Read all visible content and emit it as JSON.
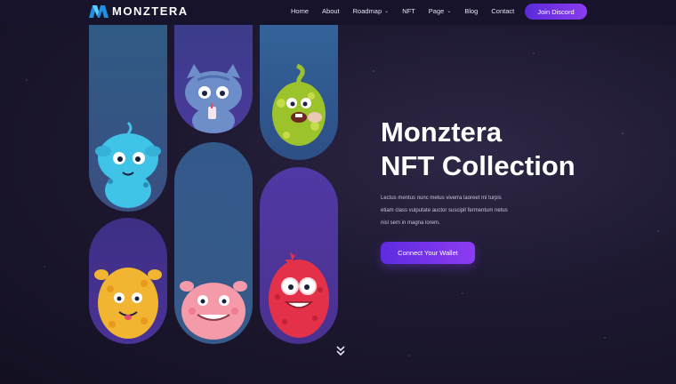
{
  "brand": {
    "name": "MONZTERA",
    "logo_icon": "m-logo-icon",
    "colors": {
      "logo_a": "#1f8fe0",
      "logo_b": "#5ad0ff"
    }
  },
  "nav": {
    "items": [
      {
        "label": "Home"
      },
      {
        "label": "About"
      },
      {
        "label": "Roadmap",
        "dropdown": true
      },
      {
        "label": "NFT"
      },
      {
        "label": "Page",
        "dropdown": true
      },
      {
        "label": "Blog"
      },
      {
        "label": "Contact"
      }
    ],
    "cta_label": "Join Discord"
  },
  "hero": {
    "title_line1": "Monztera",
    "title_line2": "NFT Collection",
    "description_line1": "Lectus mentus nunc metus viverra laoreet mi turpis",
    "description_line2": "etiam class vulputate auctor suscipit fermentum netus",
    "description_line3": "nisl sem in magna lorem.",
    "button_label": "Connect Your Wallet"
  },
  "scroll_icon": "double-chevron-down-icon",
  "gallery": {
    "monsters": [
      {
        "name": "cyan-monster",
        "color": "#3fc4e8"
      },
      {
        "name": "blue-cat-monster",
        "color": "#6e8ec9"
      },
      {
        "name": "green-monster",
        "color": "#9cc32b"
      },
      {
        "name": "orange-monster",
        "color": "#f2b531"
      },
      {
        "name": "pink-monster",
        "color": "#f49aa8"
      },
      {
        "name": "red-monster",
        "color": "#e4314a"
      }
    ]
  },
  "colors": {
    "accent": "#6a31e6",
    "background": "#1d1830",
    "header": "#17132a"
  }
}
